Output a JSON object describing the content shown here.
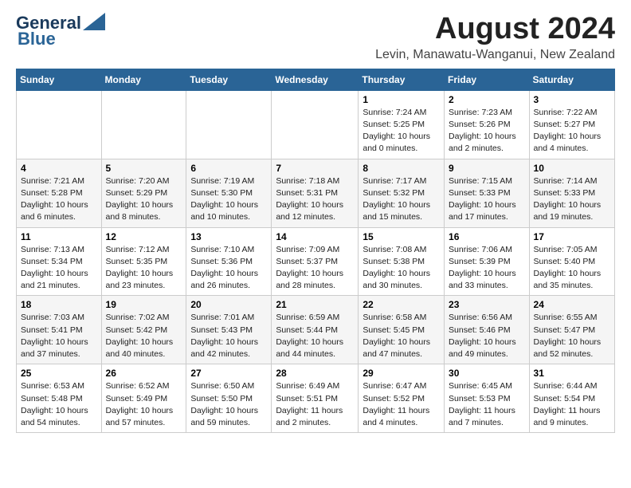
{
  "header": {
    "logo_general": "General",
    "logo_blue": "Blue",
    "month_year": "August 2024",
    "location": "Levin, Manawatu-Wanganui, New Zealand"
  },
  "days_of_week": [
    "Sunday",
    "Monday",
    "Tuesday",
    "Wednesday",
    "Thursday",
    "Friday",
    "Saturday"
  ],
  "weeks": [
    [
      {
        "num": "",
        "info": ""
      },
      {
        "num": "",
        "info": ""
      },
      {
        "num": "",
        "info": ""
      },
      {
        "num": "",
        "info": ""
      },
      {
        "num": "1",
        "info": "Sunrise: 7:24 AM\nSunset: 5:25 PM\nDaylight: 10 hours\nand 0 minutes."
      },
      {
        "num": "2",
        "info": "Sunrise: 7:23 AM\nSunset: 5:26 PM\nDaylight: 10 hours\nand 2 minutes."
      },
      {
        "num": "3",
        "info": "Sunrise: 7:22 AM\nSunset: 5:27 PM\nDaylight: 10 hours\nand 4 minutes."
      }
    ],
    [
      {
        "num": "4",
        "info": "Sunrise: 7:21 AM\nSunset: 5:28 PM\nDaylight: 10 hours\nand 6 minutes."
      },
      {
        "num": "5",
        "info": "Sunrise: 7:20 AM\nSunset: 5:29 PM\nDaylight: 10 hours\nand 8 minutes."
      },
      {
        "num": "6",
        "info": "Sunrise: 7:19 AM\nSunset: 5:30 PM\nDaylight: 10 hours\nand 10 minutes."
      },
      {
        "num": "7",
        "info": "Sunrise: 7:18 AM\nSunset: 5:31 PM\nDaylight: 10 hours\nand 12 minutes."
      },
      {
        "num": "8",
        "info": "Sunrise: 7:17 AM\nSunset: 5:32 PM\nDaylight: 10 hours\nand 15 minutes."
      },
      {
        "num": "9",
        "info": "Sunrise: 7:15 AM\nSunset: 5:33 PM\nDaylight: 10 hours\nand 17 minutes."
      },
      {
        "num": "10",
        "info": "Sunrise: 7:14 AM\nSunset: 5:33 PM\nDaylight: 10 hours\nand 19 minutes."
      }
    ],
    [
      {
        "num": "11",
        "info": "Sunrise: 7:13 AM\nSunset: 5:34 PM\nDaylight: 10 hours\nand 21 minutes."
      },
      {
        "num": "12",
        "info": "Sunrise: 7:12 AM\nSunset: 5:35 PM\nDaylight: 10 hours\nand 23 minutes."
      },
      {
        "num": "13",
        "info": "Sunrise: 7:10 AM\nSunset: 5:36 PM\nDaylight: 10 hours\nand 26 minutes."
      },
      {
        "num": "14",
        "info": "Sunrise: 7:09 AM\nSunset: 5:37 PM\nDaylight: 10 hours\nand 28 minutes."
      },
      {
        "num": "15",
        "info": "Sunrise: 7:08 AM\nSunset: 5:38 PM\nDaylight: 10 hours\nand 30 minutes."
      },
      {
        "num": "16",
        "info": "Sunrise: 7:06 AM\nSunset: 5:39 PM\nDaylight: 10 hours\nand 33 minutes."
      },
      {
        "num": "17",
        "info": "Sunrise: 7:05 AM\nSunset: 5:40 PM\nDaylight: 10 hours\nand 35 minutes."
      }
    ],
    [
      {
        "num": "18",
        "info": "Sunrise: 7:03 AM\nSunset: 5:41 PM\nDaylight: 10 hours\nand 37 minutes."
      },
      {
        "num": "19",
        "info": "Sunrise: 7:02 AM\nSunset: 5:42 PM\nDaylight: 10 hours\nand 40 minutes."
      },
      {
        "num": "20",
        "info": "Sunrise: 7:01 AM\nSunset: 5:43 PM\nDaylight: 10 hours\nand 42 minutes."
      },
      {
        "num": "21",
        "info": "Sunrise: 6:59 AM\nSunset: 5:44 PM\nDaylight: 10 hours\nand 44 minutes."
      },
      {
        "num": "22",
        "info": "Sunrise: 6:58 AM\nSunset: 5:45 PM\nDaylight: 10 hours\nand 47 minutes."
      },
      {
        "num": "23",
        "info": "Sunrise: 6:56 AM\nSunset: 5:46 PM\nDaylight: 10 hours\nand 49 minutes."
      },
      {
        "num": "24",
        "info": "Sunrise: 6:55 AM\nSunset: 5:47 PM\nDaylight: 10 hours\nand 52 minutes."
      }
    ],
    [
      {
        "num": "25",
        "info": "Sunrise: 6:53 AM\nSunset: 5:48 PM\nDaylight: 10 hours\nand 54 minutes."
      },
      {
        "num": "26",
        "info": "Sunrise: 6:52 AM\nSunset: 5:49 PM\nDaylight: 10 hours\nand 57 minutes."
      },
      {
        "num": "27",
        "info": "Sunrise: 6:50 AM\nSunset: 5:50 PM\nDaylight: 10 hours\nand 59 minutes."
      },
      {
        "num": "28",
        "info": "Sunrise: 6:49 AM\nSunset: 5:51 PM\nDaylight: 11 hours\nand 2 minutes."
      },
      {
        "num": "29",
        "info": "Sunrise: 6:47 AM\nSunset: 5:52 PM\nDaylight: 11 hours\nand 4 minutes."
      },
      {
        "num": "30",
        "info": "Sunrise: 6:45 AM\nSunset: 5:53 PM\nDaylight: 11 hours\nand 7 minutes."
      },
      {
        "num": "31",
        "info": "Sunrise: 6:44 AM\nSunset: 5:54 PM\nDaylight: 11 hours\nand 9 minutes."
      }
    ]
  ]
}
